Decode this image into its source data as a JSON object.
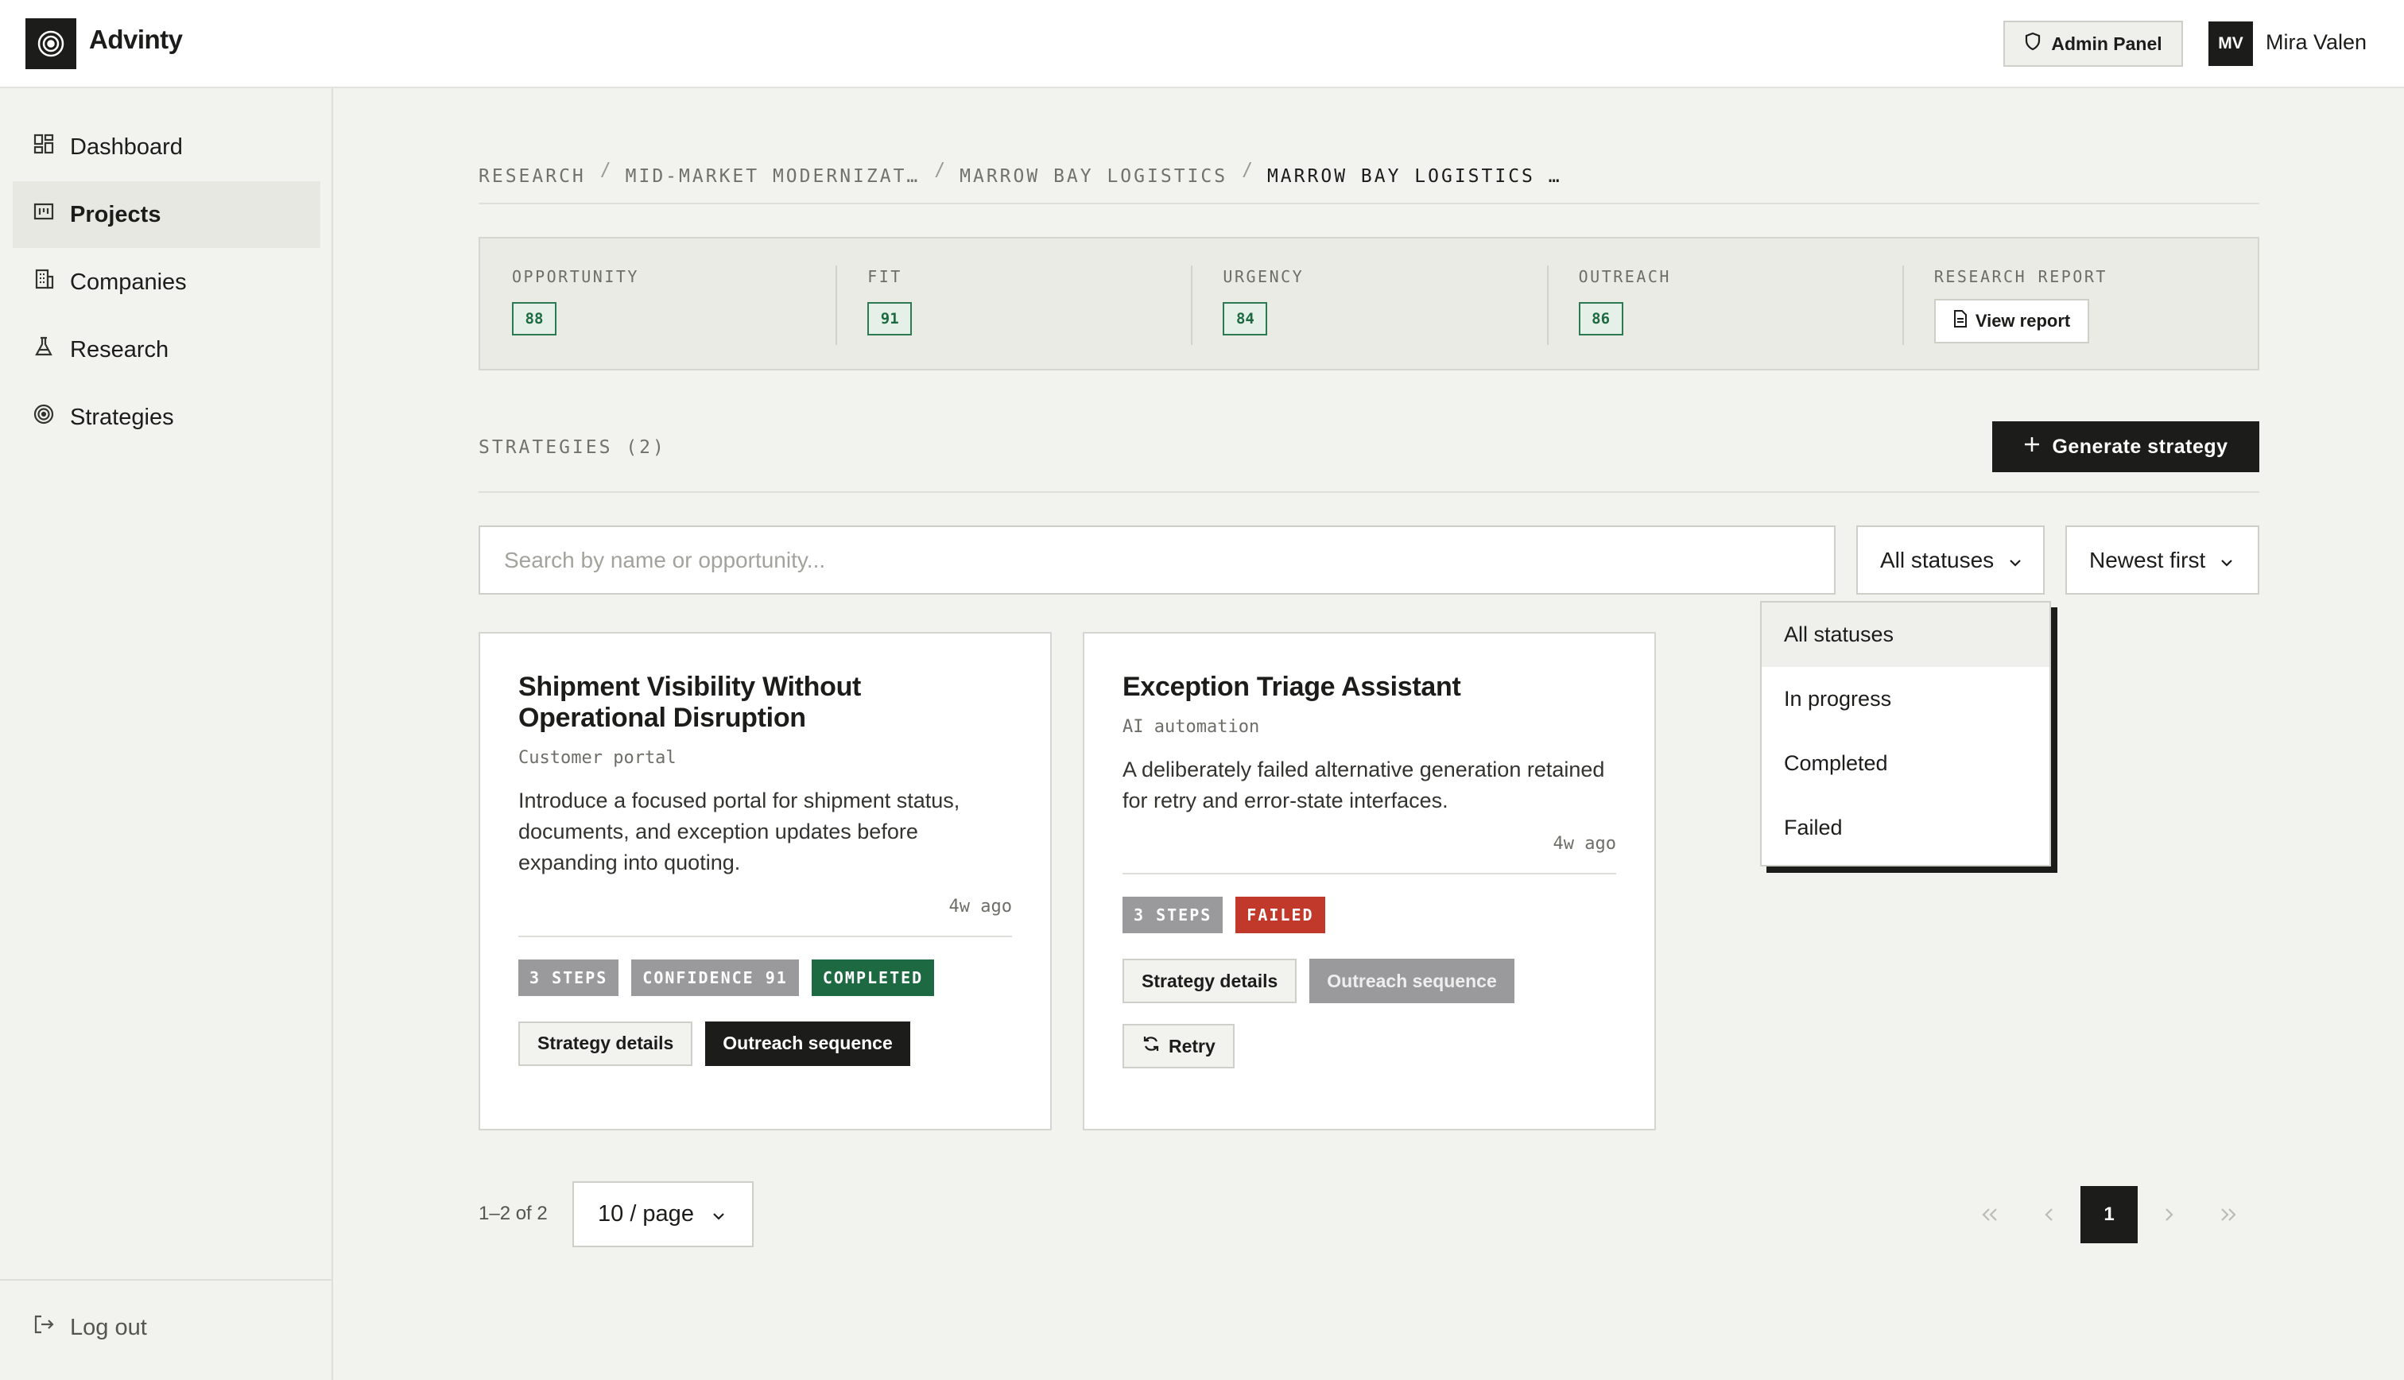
{
  "app": {
    "brand": "Advinty"
  },
  "header": {
    "admin_label": "Admin Panel",
    "avatar_initials": "MV",
    "user_name": "Mira Valen"
  },
  "sidebar": {
    "items": [
      {
        "label": "Dashboard",
        "icon": "grid-icon"
      },
      {
        "label": "Projects",
        "icon": "kanban-icon",
        "active": true
      },
      {
        "label": "Companies",
        "icon": "building-icon"
      },
      {
        "label": "Research",
        "icon": "flask-icon"
      },
      {
        "label": "Strategies",
        "icon": "target-icon"
      }
    ],
    "logout_label": "Log out"
  },
  "breadcrumb": [
    "RESEARCH",
    "MID-MARKET MODERNIZAT…",
    "MARROW BAY LOGISTICS",
    "MARROW BAY LOGISTICS …"
  ],
  "scores": [
    {
      "label": "OPPORTUNITY",
      "value": "88"
    },
    {
      "label": "FIT",
      "value": "91"
    },
    {
      "label": "URGENCY",
      "value": "84"
    },
    {
      "label": "OUTREACH",
      "value": "86"
    }
  ],
  "research_report": {
    "label": "RESEARCH REPORT",
    "button": "View report"
  },
  "strategies": {
    "title": "STRATEGIES (2)",
    "generate_label": "Generate strategy",
    "search_placeholder": "Search by name or opportunity...",
    "status_filter": "All statuses",
    "sort": "Newest first"
  },
  "cards": [
    {
      "title": "Shipment Visibility Without Operational Disruption",
      "subtitle": "Customer portal",
      "description": "Introduce a focused portal for shipment status, documents, and exception updates before expanding into quoting.",
      "time": "4w ago",
      "tags": [
        "3 STEPS",
        "CONFIDENCE 91",
        "COMPLETED"
      ],
      "actions": [
        "Strategy details",
        "Outreach sequence"
      ]
    },
    {
      "title": "Exception Triage Assistant",
      "subtitle": "AI automation",
      "description": "A deliberately failed alternative generation retained for retry and error-state interfaces.",
      "time": "4w ago",
      "tags": [
        "3 STEPS",
        "FAILED"
      ],
      "actions": [
        "Strategy details",
        "Outreach sequence"
      ],
      "retry_label": "Retry"
    }
  ],
  "dropdown": {
    "options": [
      "All statuses",
      "In progress",
      "Completed",
      "Failed"
    ],
    "selected": "All statuses"
  },
  "pagination": {
    "range": "1–2 of 2",
    "page_size": "10 / page",
    "current_page": "1"
  },
  "colors": {
    "accent_dark": "#1c1c1a",
    "score_green": "#1d6a42",
    "failed_red": "#c0392b",
    "tag_grey": "#9a9a9c"
  }
}
